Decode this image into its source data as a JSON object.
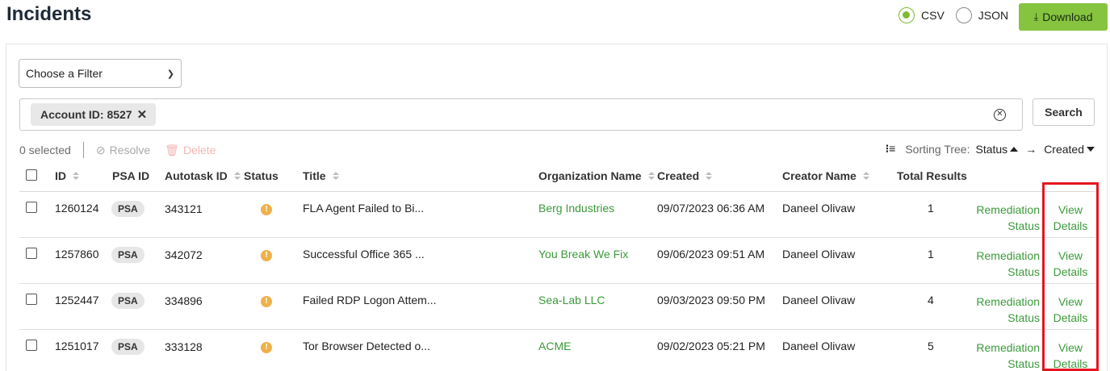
{
  "page_title": "Incidents",
  "export": {
    "formats": [
      {
        "label": "CSV",
        "checked": true
      },
      {
        "label": "JSON",
        "checked": false
      }
    ],
    "download_label": "Download"
  },
  "filter": {
    "selected": "Choose a Filter"
  },
  "search": {
    "chip_label": "Account ID: 8527",
    "button_label": "Search"
  },
  "toolbar": {
    "selected_count": "0 selected",
    "resolve_label": "Resolve",
    "delete_label": "Delete"
  },
  "sorting": {
    "label": "Sorting Tree:",
    "primary": "Status",
    "secondary": "Created"
  },
  "table": {
    "headers": {
      "id": "ID",
      "psa_id": "PSA ID",
      "autotask_id": "Autotask ID",
      "status": "Status",
      "title": "Title",
      "organization": "Organization Name",
      "created": "Created",
      "creator": "Creator Name",
      "total": "Total Results"
    },
    "rows": [
      {
        "id": "1260124",
        "psa": "PSA",
        "autotask_id": "343121",
        "status_icon": "!",
        "title": "FLA Agent Failed to Bi...",
        "organization": "Berg Industries",
        "created": "09/07/2023 06:36 AM",
        "creator": "Daneel Olivaw",
        "total": "1",
        "remediation_1": "Remediation",
        "remediation_2": "Status",
        "view_1": "View",
        "view_2": "Details"
      },
      {
        "id": "1257860",
        "psa": "PSA",
        "autotask_id": "342072",
        "status_icon": "!",
        "title": "Successful Office 365 ...",
        "organization": "You Break We Fix",
        "created": "09/06/2023 09:51 AM",
        "creator": "Daneel Olivaw",
        "total": "1",
        "remediation_1": "Remediation",
        "remediation_2": "Status",
        "view_1": "View",
        "view_2": "Details"
      },
      {
        "id": "1252447",
        "psa": "PSA",
        "autotask_id": "334896",
        "status_icon": "!",
        "title": "Failed RDP Logon Attem...",
        "organization": "Sea-Lab LLC",
        "created": "09/03/2023 09:50 PM",
        "creator": "Daneel Olivaw",
        "total": "4",
        "remediation_1": "Remediation",
        "remediation_2": "Status",
        "view_1": "View",
        "view_2": "Details"
      },
      {
        "id": "1251017",
        "psa": "PSA",
        "autotask_id": "333128",
        "status_icon": "!",
        "title": "Tor Browser Detected o...",
        "organization": "ACME",
        "created": "09/02/2023 05:21 PM",
        "creator": "Daneel Olivaw",
        "total": "5",
        "remediation_1": "Remediation",
        "remediation_2": "Status",
        "view_1": "View",
        "view_2": "Details"
      }
    ]
  },
  "colors": {
    "accent_green": "#86c440",
    "link_green": "#3b9a3b",
    "warning": "#efb14a",
    "highlight_red": "#e5161e"
  }
}
